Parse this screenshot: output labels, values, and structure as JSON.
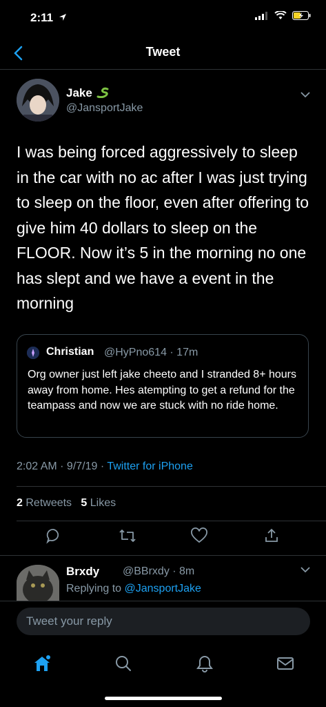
{
  "status": {
    "time": "2:11"
  },
  "nav": {
    "title": "Tweet"
  },
  "tweet": {
    "name": "Jake",
    "handle": "@JansportJake",
    "text": "I was being forced aggressively to sleep in the car with no ac after I was just trying to sleep on the floor, even after offering to give him 40 dollars to sleep on the FLOOR. Now it’s 5 in the morning no one has slept and we have a event in the morning",
    "timestamp": "2:02 AM · 9/7/19 · ",
    "source": "Twitter for iPhone",
    "retweets_count": "2",
    "retweets_label": "Retweets",
    "likes_count": "5",
    "likes_label": "Likes"
  },
  "quote": {
    "name": "Christian",
    "meta": "@HyPno614 · 17m",
    "text": "Org owner just left jake cheeto and I stranded 8+ hours away from home. Hes atempting to get a refund for the teampass and now we are stuck with no ride home."
  },
  "reply": {
    "name": "Brxdy",
    "meta": "@BBrxdy · 8m",
    "replying_label": "Replying to ",
    "mention": "@JansportJake"
  },
  "compose": {
    "placeholder": "Tweet your reply"
  },
  "colors": {
    "accent": "#1da1f2",
    "muted": "#8899a6",
    "divider": "#2f3336"
  }
}
